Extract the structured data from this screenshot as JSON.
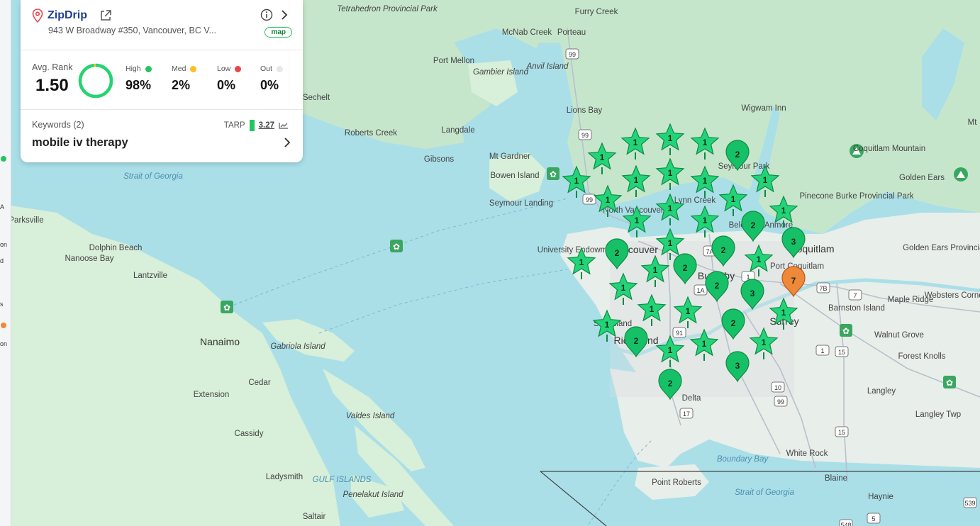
{
  "business": {
    "name": "ZipDrip",
    "address": "943 W Broadway #350, Vancouver, BC V...",
    "map_badge": "map"
  },
  "stats": {
    "avg_rank_label": "Avg. Rank",
    "avg_rank_value": "1.50",
    "ring_fraction": 0.98,
    "high": {
      "label": "High",
      "value": "98%",
      "color": "#22c55e"
    },
    "med": {
      "label": "Med",
      "value": "2%",
      "color": "#fbbf24"
    },
    "low": {
      "label": "Low",
      "value": "0%",
      "color": "#ef4444"
    },
    "out": {
      "label": "Out",
      "value": "0%",
      "color": "#e5e7eb"
    }
  },
  "keywords": {
    "label": "Keywords (2)",
    "value": "mobile iv therapy",
    "tarp_label": "TARP",
    "tarp_value": "3.27"
  },
  "left_fragments": [
    "A",
    "on",
    "d",
    "s",
    "on"
  ],
  "map_labels": [
    "Tetrahedron Provincial Park",
    "Furry Creek",
    "McNab Creek",
    "Porteau",
    "Port Mellon",
    "Gambier Island",
    "Anvil Island",
    "Lions Bay",
    "Wigwam Inn",
    "Mt",
    "Sechelt",
    "Roberts Creek",
    "Langdale",
    "Gibsons",
    "Mt Gardner",
    "Bowen Island",
    "Coquitlam Mountain",
    "Golden Ears",
    "Strait of Georgia",
    "Seymour Landing",
    "Pinecone Burke Provincial Park",
    "Parksville",
    "Dolphin Beach",
    "Nanoose Bay",
    "Lantzville",
    "University Endowment",
    "Golden Ears Provincial Park",
    "Port Coquitlam",
    "Coquitlam",
    "Burnaby",
    "Vancouver",
    "North Vancouver",
    "Lynn Creek",
    "Seymour Park",
    "Belcarra",
    "Anmore",
    "Maple Ridge",
    "Websters Corners",
    "Barnston Island",
    "Walnut Grove",
    "Forest Knolls",
    "Langley",
    "Langley Twp",
    "Nanaimo",
    "Gabriola Island",
    "Richmond",
    "Sea Island",
    "Surrey",
    "Extension",
    "Cedar",
    "Valdes Island",
    "Delta",
    "Cassidy",
    "Ladysmith",
    "Boundary Bay",
    "Point Roberts",
    "White Rock",
    "Blaine",
    "Haynie",
    "Strait of Georgia",
    "Penelakut Island",
    "Saltair",
    "GULF ISLANDS"
  ],
  "road_shields": [
    "99",
    "99",
    "99",
    "7A",
    "1A",
    "91",
    "17",
    "10",
    "15",
    "7",
    "7B",
    "1",
    "1",
    "15",
    "99",
    "5",
    "539",
    "548"
  ],
  "markers": [
    {
      "type": "star",
      "label": "1",
      "color": "#22d477"
    },
    {
      "type": "star",
      "label": "1",
      "color": "#22d477"
    },
    {
      "type": "star",
      "label": "1",
      "color": "#22d477"
    },
    {
      "type": "star",
      "label": "1",
      "color": "#22d477"
    },
    {
      "type": "pin",
      "label": "2",
      "color": "#16c067"
    },
    {
      "type": "star",
      "label": "1",
      "color": "#22d477"
    },
    {
      "type": "star",
      "label": "1",
      "color": "#22d477"
    },
    {
      "type": "star",
      "label": "1",
      "color": "#22d477"
    },
    {
      "type": "star",
      "label": "1",
      "color": "#22d477"
    },
    {
      "type": "star",
      "label": "1",
      "color": "#22d477"
    },
    {
      "type": "star",
      "label": "1",
      "color": "#22d477"
    },
    {
      "type": "star",
      "label": "1",
      "color": "#22d477"
    },
    {
      "type": "star",
      "label": "1",
      "color": "#22d477"
    },
    {
      "type": "star",
      "label": "1",
      "color": "#22d477"
    },
    {
      "type": "star",
      "label": "1",
      "color": "#22d477"
    },
    {
      "type": "star",
      "label": "1",
      "color": "#22d477"
    },
    {
      "type": "pin",
      "label": "2",
      "color": "#16c067"
    },
    {
      "type": "pin",
      "label": "3",
      "color": "#16c067"
    },
    {
      "type": "star",
      "label": "1",
      "color": "#22d477"
    },
    {
      "type": "pin",
      "label": "2",
      "color": "#16c067"
    },
    {
      "type": "pin",
      "label": "2",
      "color": "#16c067"
    },
    {
      "type": "star",
      "label": "1",
      "color": "#22d477"
    },
    {
      "type": "star",
      "label": "1",
      "color": "#22d477"
    },
    {
      "type": "pin",
      "label": "2",
      "color": "#16c067"
    },
    {
      "type": "star",
      "label": "1",
      "color": "#22d477"
    },
    {
      "type": "pin",
      "label": "2",
      "color": "#16c067"
    },
    {
      "type": "pin",
      "label": "3",
      "color": "#16c067"
    },
    {
      "type": "pin",
      "label": "7",
      "color": "#f0883a"
    },
    {
      "type": "star",
      "label": "1",
      "color": "#22d477"
    },
    {
      "type": "star",
      "label": "1",
      "color": "#22d477"
    },
    {
      "type": "star",
      "label": "1",
      "color": "#22d477"
    },
    {
      "type": "star",
      "label": "1",
      "color": "#22d477"
    },
    {
      "type": "pin",
      "label": "2",
      "color": "#16c067"
    },
    {
      "type": "star",
      "label": "1",
      "color": "#22d477"
    },
    {
      "type": "star",
      "label": "1",
      "color": "#22d477"
    },
    {
      "type": "star",
      "label": "1",
      "color": "#22d477"
    },
    {
      "type": "star",
      "label": "1",
      "color": "#22d477"
    },
    {
      "type": "pin",
      "label": "2",
      "color": "#16c067"
    },
    {
      "type": "pin",
      "label": "3",
      "color": "#16c067"
    },
    {
      "type": "pin",
      "label": "2",
      "color": "#16c067"
    }
  ]
}
